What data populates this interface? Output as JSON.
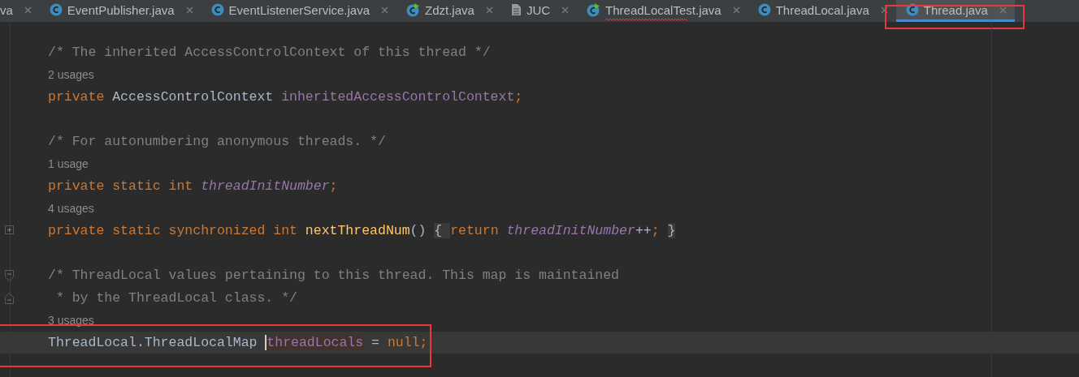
{
  "tabs": [
    {
      "label": "va",
      "kind": "plain",
      "selected": false,
      "error": false,
      "annotated": false
    },
    {
      "label": "EventPublisher.java",
      "kind": "class",
      "selected": false,
      "error": false,
      "annotated": false
    },
    {
      "label": "EventListenerService.java",
      "kind": "class",
      "selected": false,
      "error": false,
      "annotated": false
    },
    {
      "label": "Zdzt.java",
      "kind": "runnable",
      "selected": false,
      "error": false,
      "annotated": false
    },
    {
      "label": "JUC",
      "kind": "file",
      "selected": false,
      "error": false,
      "annotated": false
    },
    {
      "label": "ThreadLocalTest.java",
      "kind": "runnable",
      "selected": false,
      "error": true,
      "annotated": false
    },
    {
      "label": "ThreadLocal.java",
      "kind": "class",
      "selected": false,
      "error": false,
      "annotated": false
    },
    {
      "label": "Thread.java",
      "kind": "class",
      "selected": true,
      "error": false,
      "annotated": true
    }
  ],
  "editor": {
    "lines": [
      {
        "kind": "code",
        "current": false,
        "annotated": false,
        "tokens": [
          {
            "text": "/* The inherited AccessControlContext of this thread */",
            "kind": "comment"
          }
        ]
      },
      {
        "kind": "usages",
        "text": "2 usages"
      },
      {
        "kind": "code",
        "current": false,
        "annotated": false,
        "tokens": [
          {
            "text": "private ",
            "kind": "keyword"
          },
          {
            "text": "AccessControlContext ",
            "kind": "plain"
          },
          {
            "text": "inheritedAccessControlContext",
            "kind": "field"
          },
          {
            "text": ";",
            "kind": "keyword"
          }
        ]
      },
      {
        "kind": "blank"
      },
      {
        "kind": "code",
        "current": false,
        "annotated": false,
        "tokens": [
          {
            "text": "/* For autonumbering anonymous threads. */",
            "kind": "comment"
          }
        ]
      },
      {
        "kind": "usages",
        "text": "1 usage"
      },
      {
        "kind": "code",
        "current": false,
        "annotated": false,
        "tokens": [
          {
            "text": "private static int ",
            "kind": "keyword"
          },
          {
            "text": "threadInitNumber",
            "kind": "static-field"
          },
          {
            "text": ";",
            "kind": "keyword"
          }
        ]
      },
      {
        "kind": "usages",
        "text": "4 usages"
      },
      {
        "kind": "folded",
        "current": false,
        "annotated": false,
        "tokens": [
          {
            "text": "private static synchronized int ",
            "kind": "keyword"
          },
          {
            "text": "nextThreadNum",
            "kind": "method"
          },
          {
            "text": "() ",
            "kind": "plain"
          },
          {
            "text": "{ ",
            "kind": "fold-brace"
          },
          {
            "text": "return ",
            "kind": "keyword"
          },
          {
            "text": "threadInitNumber",
            "kind": "static-field"
          },
          {
            "text": "++",
            "kind": "plain"
          },
          {
            "text": "; ",
            "kind": "keyword"
          },
          {
            "text": "}",
            "kind": "fold-brace"
          }
        ]
      },
      {
        "kind": "blank"
      },
      {
        "kind": "fold-start",
        "current": false,
        "annotated": false,
        "tokens": [
          {
            "text": "/* ThreadLocal values pertaining to this thread. This map is maintained",
            "kind": "comment"
          }
        ]
      },
      {
        "kind": "fold-end",
        "current": false,
        "annotated": false,
        "tokens": [
          {
            "text": " * by the ThreadLocal class. */",
            "kind": "comment"
          }
        ]
      },
      {
        "kind": "usages",
        "text": "3 usages"
      },
      {
        "kind": "code",
        "current": true,
        "annotated": true,
        "tokens": [
          {
            "text": "ThreadLocal.ThreadLocalMap ",
            "kind": "plain"
          },
          {
            "text": "threadLocals",
            "kind": "caret-usage-field"
          },
          {
            "text": " = ",
            "kind": "plain"
          },
          {
            "text": "null;",
            "kind": "keyword"
          }
        ]
      }
    ]
  }
}
